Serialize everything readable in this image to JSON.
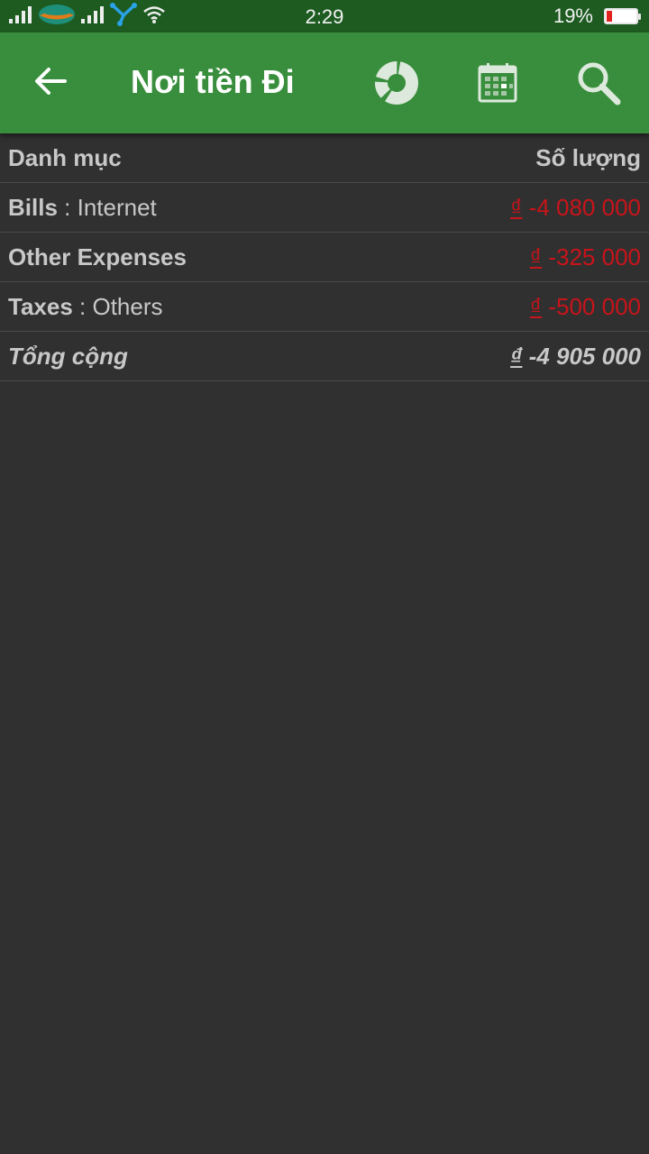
{
  "status_bar": {
    "time": "2:29",
    "battery_percent": "19%",
    "battery_level": 0.19,
    "battery_color": "#e0231d"
  },
  "app_bar": {
    "title": "Nơi tiền Đi",
    "background": "#388e3c",
    "actions": [
      "back-icon",
      "donut-chart-icon",
      "calendar-icon",
      "search-icon"
    ]
  },
  "table": {
    "header": {
      "category": "Danh mục",
      "amount": "Số lượng"
    },
    "rows": [
      {
        "category": "Bills",
        "subcategory": " : Internet",
        "currency": "₫",
        "amount": " -4 080 000"
      },
      {
        "category": "Other Expenses",
        "subcategory": "",
        "currency": "₫",
        "amount": " -325 000"
      },
      {
        "category": "Taxes",
        "subcategory": " : Others",
        "currency": "₫",
        "amount": " -500 000"
      }
    ],
    "total": {
      "label": "Tổng cộng",
      "currency": "₫",
      "amount": " -4 905 000"
    },
    "negative_color": "#c8141a"
  }
}
